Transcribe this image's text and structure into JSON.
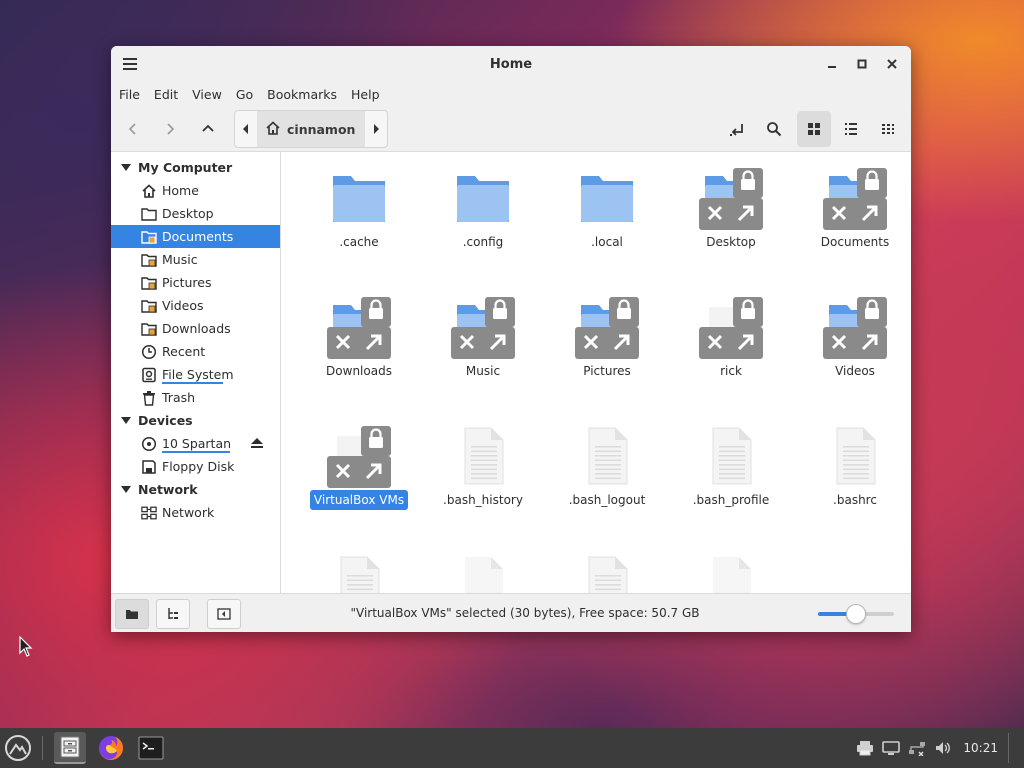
{
  "window": {
    "title": "Home",
    "menu": [
      "File",
      "Edit",
      "View",
      "Go",
      "Bookmarks",
      "Help"
    ]
  },
  "toolbar": {
    "path_crumb": "cinnamon",
    "view_mode": "icon-view"
  },
  "sidebar": {
    "sections": [
      {
        "label": "My Computer",
        "items": [
          {
            "label": "Home",
            "icon": "home-icon"
          },
          {
            "label": "Desktop",
            "icon": "folder-icon"
          },
          {
            "label": "Documents",
            "icon": "folder-documents-icon",
            "selected": true
          },
          {
            "label": "Music",
            "icon": "folder-music-icon"
          },
          {
            "label": "Pictures",
            "icon": "folder-pictures-icon"
          },
          {
            "label": "Videos",
            "icon": "folder-videos-icon"
          },
          {
            "label": "Downloads",
            "icon": "folder-downloads-icon"
          },
          {
            "label": "Recent",
            "icon": "recent-icon"
          },
          {
            "label": "File System",
            "icon": "filesystem-icon",
            "usage": 0.85
          },
          {
            "label": "Trash",
            "icon": "trash-icon"
          }
        ]
      },
      {
        "label": "Devices",
        "items": [
          {
            "label": "10 Spartan",
            "icon": "optical-disc-icon",
            "usage": 0.95,
            "eject": true
          },
          {
            "label": "Floppy Disk",
            "icon": "floppy-icon"
          }
        ]
      },
      {
        "label": "Network",
        "items": [
          {
            "label": "Network",
            "icon": "network-icon"
          }
        ]
      }
    ]
  },
  "files": [
    {
      "name": ".cache",
      "type": "folder"
    },
    {
      "name": ".config",
      "type": "folder"
    },
    {
      "name": ".local",
      "type": "folder"
    },
    {
      "name": "Desktop",
      "type": "broken-link-folder"
    },
    {
      "name": "Documents",
      "type": "broken-link-folder"
    },
    {
      "name": "Downloads",
      "type": "broken-link-folder"
    },
    {
      "name": "Music",
      "type": "broken-link-folder"
    },
    {
      "name": "Pictures",
      "type": "broken-link-folder"
    },
    {
      "name": "rick",
      "type": "broken-link"
    },
    {
      "name": "Videos",
      "type": "broken-link-folder"
    },
    {
      "name": "VirtualBox VMs",
      "type": "broken-link",
      "selected": true
    },
    {
      "name": ".bash_history",
      "type": "text"
    },
    {
      "name": ".bash_logout",
      "type": "text"
    },
    {
      "name": ".bash_profile",
      "type": "text"
    },
    {
      "name": ".bashrc",
      "type": "text"
    },
    {
      "name": "",
      "type": "text"
    },
    {
      "name": "",
      "type": "blank"
    },
    {
      "name": "",
      "type": "text"
    },
    {
      "name": "",
      "type": "blank"
    }
  ],
  "statusbar": {
    "text": "\"VirtualBox VMs\" selected (30 bytes), Free space: 50.7 GB",
    "zoom_level": 0.5
  },
  "taskbar": {
    "apps": [
      {
        "name": "menu-icon"
      },
      {
        "name": "file-manager-icon",
        "active": true
      },
      {
        "name": "firefox-icon"
      },
      {
        "name": "terminal-icon"
      }
    ],
    "tray": [
      "printer-icon",
      "display-icon",
      "network-icon",
      "volume-icon"
    ],
    "clock": "10:21"
  },
  "colors": {
    "accent": "#3584e4",
    "folder": "#5d9be6",
    "folder_light": "#9cc3f2",
    "lock_badge": "#8a8a8a"
  }
}
